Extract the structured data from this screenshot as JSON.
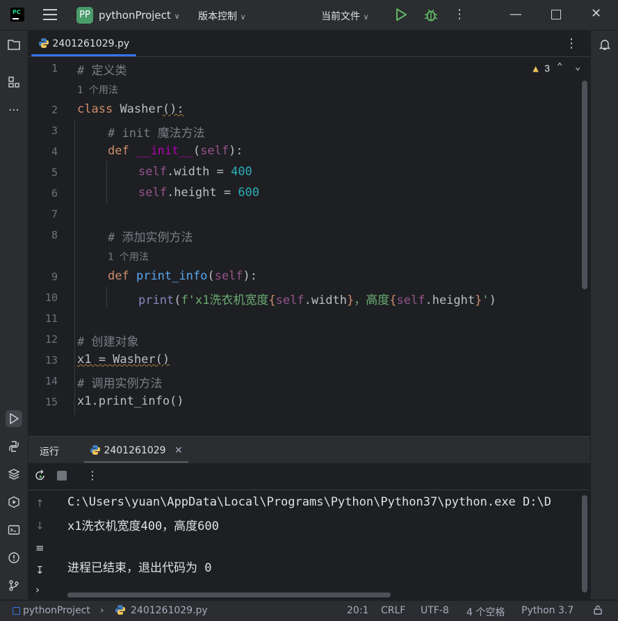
{
  "titlebar": {
    "project_badge": "PP",
    "project_name": "pythonProject",
    "vcs_label": "版本控制",
    "current_file_label": "当前文件"
  },
  "editor": {
    "tab_label": "2401261029.py",
    "warning_count": "3",
    "line_numbers": [
      "1",
      "2",
      "3",
      "4",
      "5",
      "6",
      "7",
      "8",
      "9",
      "10",
      "11",
      "12",
      "13",
      "14",
      "15"
    ],
    "usage_hint": "1 个用法",
    "code": {
      "l1": "# 定义类",
      "l2_kw": "class",
      "l2_name": "Washer",
      "l2_rest": "():",
      "l3": "# init 魔法方法",
      "l4_kw": "def",
      "l4_name": "__init__",
      "l4_self": "self",
      "l5_self": "self",
      "l5_attr": ".width = ",
      "l5_val": "400",
      "l6_self": "self",
      "l6_attr": ".height = ",
      "l6_val": "600",
      "l8": "# 添加实例方法",
      "l9_kw": "def",
      "l9_name": "print_info",
      "l9_self": "self",
      "l10_print": "print",
      "l10_str1": "f'x1洗衣机宽度",
      "l10_self1": "self",
      "l10_attr1": ".width",
      "l10_str2": "，高度",
      "l10_self2": "self",
      "l10_attr2": ".height",
      "l10_str3": "'",
      "l12": "# 创建对象",
      "l13": "x1 = Washer()",
      "l14": "# 调用实例方法",
      "l15": "x1.print_info()"
    }
  },
  "run_panel": {
    "title": "运行",
    "tab_label": "2401261029",
    "output_lines": [
      "C:\\Users\\yuan\\AppData\\Local\\Programs\\Python\\Python37\\python.exe D:\\D",
      "x1洗衣机宽度400，高度600",
      "",
      "进程已结束，退出代码为 0"
    ]
  },
  "statusbar": {
    "project": "pythonProject",
    "file": "2401261029.py",
    "position": "20:1",
    "line_ending": "CRLF",
    "encoding": "UTF-8",
    "indent": "4 个空格",
    "interpreter": "Python 3.7"
  },
  "colors": {
    "accent": "#3574f0",
    "run_green": "#5fb865",
    "warning": "#f2c55c"
  }
}
